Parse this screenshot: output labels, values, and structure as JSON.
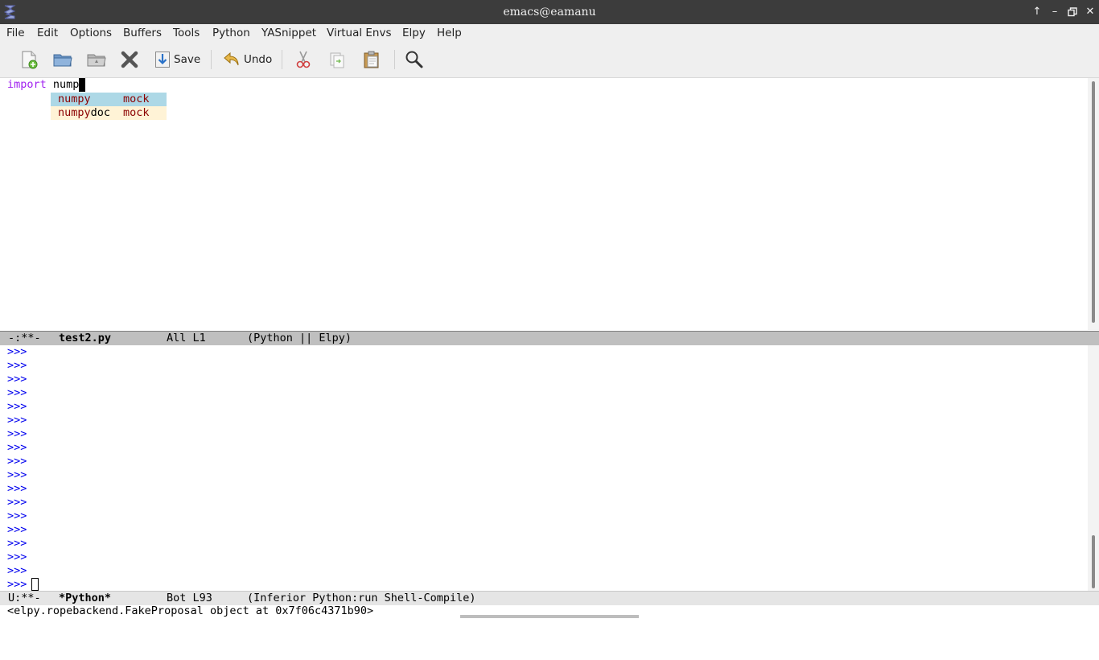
{
  "window": {
    "title": "emacs@eamanu"
  },
  "menu": [
    "File",
    "Edit",
    "Options",
    "Buffers",
    "Tools",
    "Python",
    "YASnippet",
    "Virtual Envs",
    "Elpy",
    "Help"
  ],
  "toolbar": {
    "save_label": "Save",
    "undo_label": "Undo"
  },
  "editor": {
    "keyword": "import",
    "typed": "nump",
    "completions": [
      {
        "match": "numpy",
        "rest": "",
        "annotation": "mock"
      },
      {
        "match": "numpy",
        "rest": "doc",
        "annotation": "mock"
      }
    ]
  },
  "modeline_top": {
    "status": "-:**-",
    "buffer": "test2.py",
    "position": "All L1",
    "modes": "(Python || Elpy)"
  },
  "shell": {
    "prompt": ">>>",
    "prompt_count": 18
  },
  "modeline_bottom": {
    "status": "U:**-",
    "buffer": "*Python*",
    "position": "Bot L93",
    "modes": "(Inferior Python:run Shell-Compile)"
  },
  "echo": "<elpy.ropebackend.FakeProposal object at 0x7f06c4371b90>",
  "colors": {
    "keyword": "#a020f0",
    "prompt": "#0000ee",
    "selected_completion": "#add8e6",
    "completion": "#fff3d6",
    "annotation": "#8b0000"
  },
  "icons": [
    "new-file-icon",
    "open-folder-icon",
    "dired-icon",
    "close-icon",
    "save-icon",
    "undo-icon",
    "cut-icon",
    "copy-icon",
    "paste-icon",
    "search-icon"
  ]
}
